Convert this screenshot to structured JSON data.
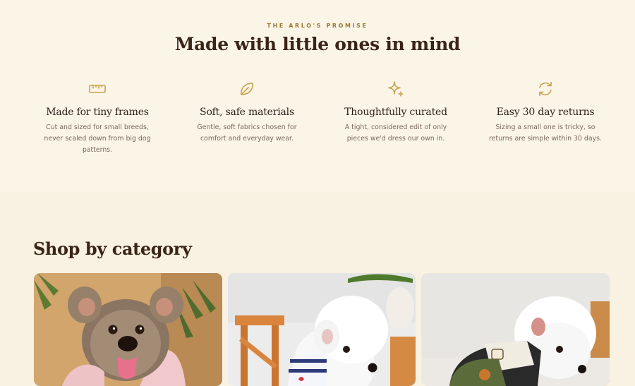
{
  "promise": {
    "eyebrow": "THE ARLO'S PROMISE",
    "title": "Made with little ones in mind",
    "features": [
      {
        "icon": "ruler-icon",
        "title": "Made for tiny frames",
        "description": "Cut and sized for small breeds, never scaled down from big dog patterns."
      },
      {
        "icon": "leaf-icon",
        "title": "Soft, safe materials",
        "description": "Gentle, soft fabrics chosen for comfort and everyday wear."
      },
      {
        "icon": "sparkle-icon",
        "title": "Thoughtfully curated",
        "description": "A tight, considered edit of only pieces we'd dress our own in."
      },
      {
        "icon": "refresh-icon",
        "title": "Easy 30 day returns",
        "description": "Sizing a small one is tricky, so returns are simple within 30 days."
      }
    ]
  },
  "categories": {
    "title": "Shop by category",
    "cards": [
      {
        "image": "yorkie-dog-in-pink-hoodie-photo"
      },
      {
        "image": "white-poodle-in-striped-shirt-photo"
      },
      {
        "image": "white-poodle-in-corduroy-jacket-photo"
      }
    ]
  },
  "colors": {
    "accent": "#c9a24a",
    "eyebrow": "#9a7a2c",
    "heading": "#3b2418",
    "body_text": "#7a6a5c",
    "promise_bg": "#fbf5e8",
    "category_bg": "#f9f2e2"
  }
}
